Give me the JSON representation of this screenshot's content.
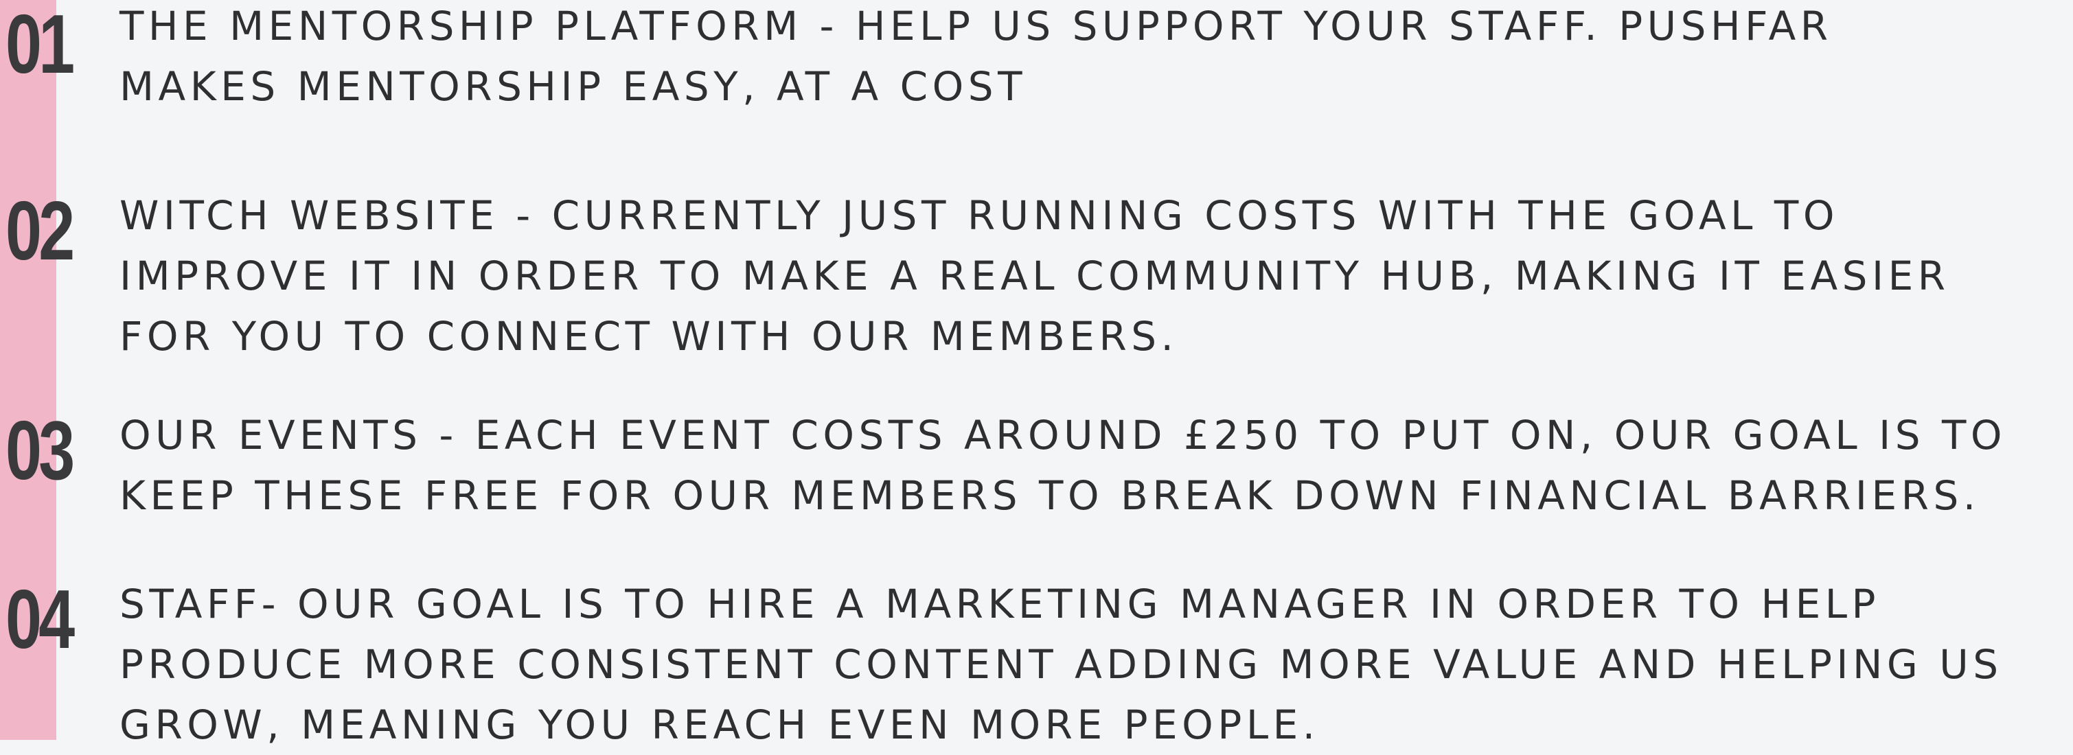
{
  "items": [
    {
      "number": "01",
      "text": "THE MENTORSHIP PLATFORM - HELP US SUPPORT YOUR STAFF. PUSHFAR\nMAKES MENTORSHIP EASY, AT A COST"
    },
    {
      "number": "02",
      "text": "WITCH WEBSITE - CURRENTLY JUST RUNNING COSTS WITH THE GOAL TO\nIMPROVE IT IN ORDER TO MAKE A REAL COMMUNITY HUB, MAKING IT EASIER\nFOR YOU TO CONNECT WITH OUR MEMBERS."
    },
    {
      "number": "03",
      "text": "OUR EVENTS - EACH EVENT COSTS AROUND £250 TO PUT ON, OUR GOAL IS TO\nKEEP THESE FREE FOR OUR MEMBERS TO BREAK DOWN FINANCIAL BARRIERS."
    },
    {
      "number": "04",
      "text": "STAFF- OUR GOAL IS TO HIRE A MARKETING MANAGER IN ORDER TO HELP\nPRODUCE MORE CONSISTENT CONTENT ADDING MORE VALUE AND HELPING US\nGROW, MEANING YOU REACH EVEN MORE PEOPLE."
    }
  ],
  "colors": {
    "background": "#f4f5f7",
    "accent_bar": "#f1b7c8",
    "number": "#3a3a3c",
    "text": "#2f2f31"
  }
}
